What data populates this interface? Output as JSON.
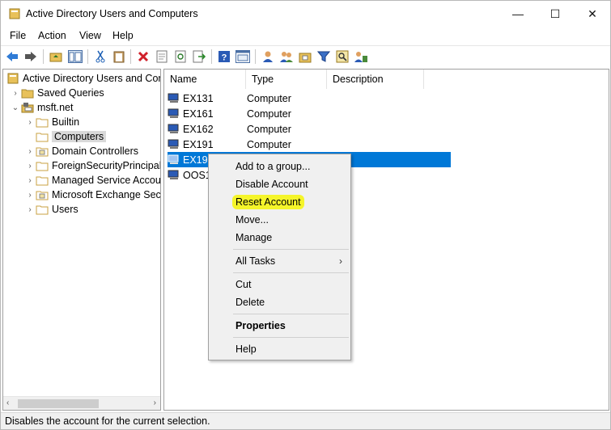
{
  "window": {
    "title": "Active Directory Users and Computers",
    "controls": {
      "minimize": "—",
      "maximize": "☐",
      "close": "✕"
    }
  },
  "menubar": {
    "items": [
      "File",
      "Action",
      "View",
      "Help"
    ]
  },
  "toolbar": {
    "icons": [
      "back-arrow-icon",
      "forward-arrow-icon",
      "folder-up-icon",
      "show-tree-icon",
      "cut-icon",
      "clipboard-icon",
      "delete-icon",
      "properties-icon",
      "refresh-icon",
      "export-list-icon",
      "help-icon",
      "console-icon",
      "add-user-icon",
      "add-group-icon",
      "add-ou-icon",
      "filter-icon",
      "find-icon",
      "delegate-icon"
    ]
  },
  "tree": {
    "root": "Active Directory Users and Com",
    "items": [
      {
        "label": "Saved Queries",
        "level": 1,
        "expander": "›",
        "icon": "folder"
      },
      {
        "label": "msft.net",
        "level": 1,
        "expander": "⌄",
        "icon": "domain"
      },
      {
        "label": "Builtin",
        "level": 2,
        "expander": "›",
        "icon": "folder"
      },
      {
        "label": "Computers",
        "level": 2,
        "expander": "",
        "icon": "folder",
        "selected": true
      },
      {
        "label": "Domain Controllers",
        "level": 2,
        "expander": "›",
        "icon": "ou"
      },
      {
        "label": "ForeignSecurityPrincipals",
        "level": 2,
        "expander": "›",
        "icon": "folder"
      },
      {
        "label": "Managed Service Accour",
        "level": 2,
        "expander": "›",
        "icon": "folder"
      },
      {
        "label": "Microsoft Exchange Secu",
        "level": 2,
        "expander": "›",
        "icon": "ou"
      },
      {
        "label": "Users",
        "level": 2,
        "expander": "›",
        "icon": "folder"
      }
    ],
    "scroll_left": "‹",
    "scroll_right": "›"
  },
  "list": {
    "columns": [
      "Name",
      "Type",
      "Description"
    ],
    "rows": [
      {
        "name": "EX131",
        "type": "Computer"
      },
      {
        "name": "EX161",
        "type": "Computer"
      },
      {
        "name": "EX162",
        "type": "Computer"
      },
      {
        "name": "EX191",
        "type": "Computer"
      },
      {
        "name": "EX192",
        "type": "",
        "selected": true
      },
      {
        "name": "OOS1",
        "type": ""
      }
    ]
  },
  "context_menu": {
    "items": [
      "Add to a group...",
      "Disable Account",
      "Reset Account",
      "Move...",
      "Manage",
      "All Tasks",
      "Cut",
      "Delete",
      "Properties",
      "Help"
    ],
    "all_tasks_arrow": "›",
    "highlighted": "Reset Account",
    "highlight_color": "#f5f52a"
  },
  "statusbar": {
    "text": "Disables the account for the current selection."
  },
  "colors": {
    "selection": "#0078d7",
    "tree_selection": "#d9d9d9",
    "folder": "#e8c15a"
  }
}
